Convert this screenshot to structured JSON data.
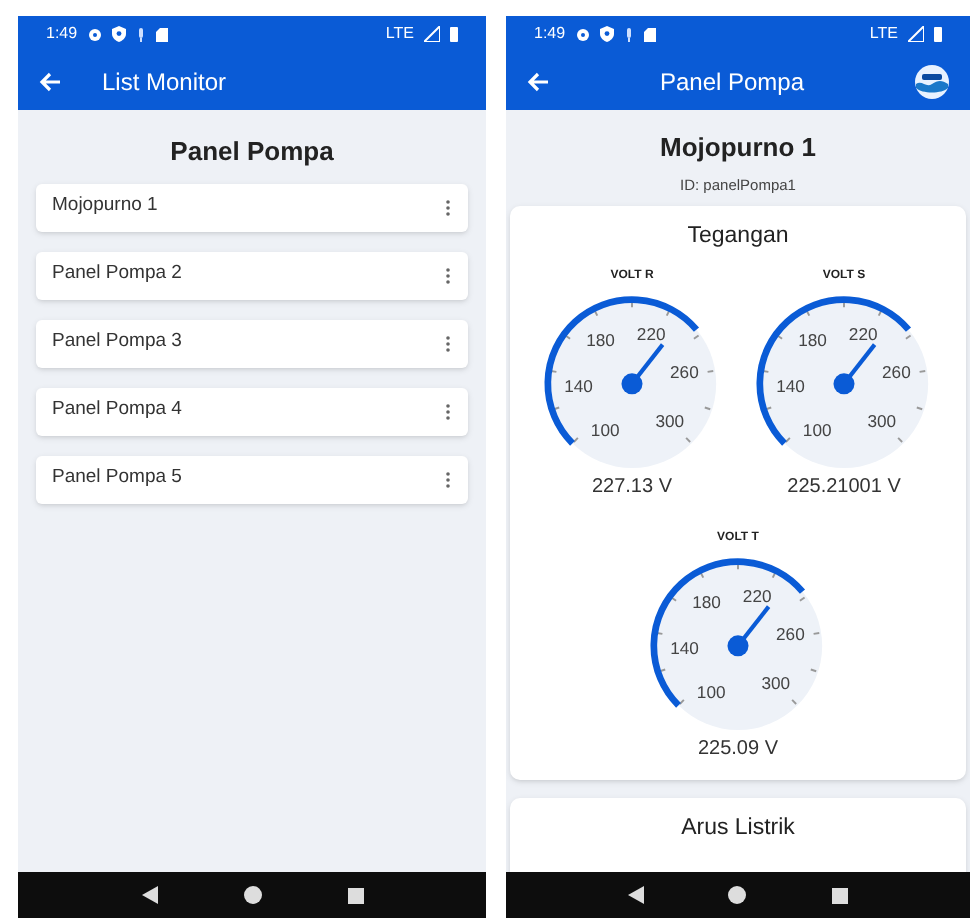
{
  "screens": [
    {
      "status_bar": {
        "time": "1:49",
        "network": "LTE"
      },
      "app_bar": {
        "title": "List Monitor"
      },
      "heading": "Panel Pompa",
      "items": [
        {
          "label": "Mojopurno 1"
        },
        {
          "label": "Panel Pompa 2"
        },
        {
          "label": "Panel Pompa 3"
        },
        {
          "label": "Panel Pompa 4"
        },
        {
          "label": "Panel Pompa 5"
        }
      ]
    },
    {
      "status_bar": {
        "time": "1:49",
        "network": "LTE"
      },
      "app_bar": {
        "title": "Panel Pompa",
        "logo": true
      },
      "heading": "Mojopurno 1",
      "subheading": "ID: panelPompa1",
      "cards": [
        {
          "title": "Tegangan",
          "gauges": [
            {
              "label": "VOLT R",
              "scale": [
                "100",
                "140",
                "180",
                "220",
                "260",
                "300"
              ],
              "reading": "227.13 V"
            },
            {
              "label": "VOLT S",
              "scale": [
                "100",
                "140",
                "180",
                "220",
                "260",
                "300"
              ],
              "reading": "225.21001 V"
            },
            {
              "label": "VOLT T",
              "scale": [
                "100",
                "140",
                "180",
                "220",
                "260",
                "300"
              ],
              "reading": "225.09 V"
            }
          ]
        },
        {
          "title": "Arus Listrik"
        }
      ]
    }
  ]
}
